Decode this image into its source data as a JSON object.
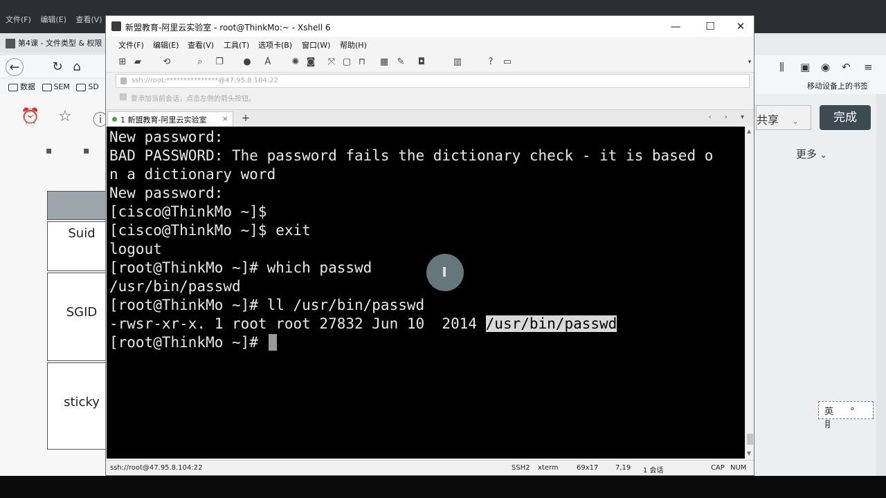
{
  "background": {
    "top_menu": [
      "文件(F)",
      "编辑(E)",
      "查看(V)"
    ],
    "tab_title": "第4课 - 文件类型 & 权限",
    "bookmarks": [
      "数据",
      "SEM",
      "SD"
    ],
    "table_rows": [
      "Suid",
      "SGID",
      "sticky"
    ],
    "share_label": "共享",
    "done_label": "完成",
    "more_label": "更多",
    "mobile_bookmarks": "移动设备上的书签",
    "ime_chars": "英 ° ⺝"
  },
  "xshell": {
    "window_title": "新盟教育-阿里云实验室 - root@ThinkMo:~ - Xshell 6",
    "menu": [
      "文件(F)",
      "编辑(E)",
      "查看(V)",
      "工具(T)",
      "选项卡(B)",
      "窗口(W)",
      "帮助(H)"
    ],
    "address": "ssh://root:***************@47.95.8.104:22",
    "hint": "要添加当前会话，点击左侧的箭头按钮。",
    "active_tab": "1 新盟教育-阿里云实验室",
    "add_tab": "+",
    "terminal_lines": [
      "New password:",
      "BAD PASSWORD: The password fails the dictionary check - it is based o",
      "n a dictionary word",
      "New password:",
      "[cisco@ThinkMo ~]$",
      "[cisco@ThinkMo ~]$ exit",
      "logout",
      "[root@ThinkMo ~]# which passwd",
      "/usr/bin/passwd",
      "[root@ThinkMo ~]# ll /usr/bin/passwd"
    ],
    "ls_line_prefix": "-rwsr-xr-x. 1 root root 27832 Jun 10  2014 ",
    "ls_line_highlight": "/usr/bin/passwd",
    "prompt_line": "[root@ThinkMo ~]# ",
    "status": {
      "connection": "ssh://root@47.95.8.104:22",
      "protocol": "SSH2",
      "terminal": "xterm",
      "size": "69x17",
      "position": "7,19",
      "sessions": "1 会话",
      "cap": "CAP",
      "num": "NUM"
    }
  },
  "colors": {
    "terminal_bg": "#000000",
    "terminal_fg": "#e8e8e8",
    "done_button": "#3d4a52"
  }
}
